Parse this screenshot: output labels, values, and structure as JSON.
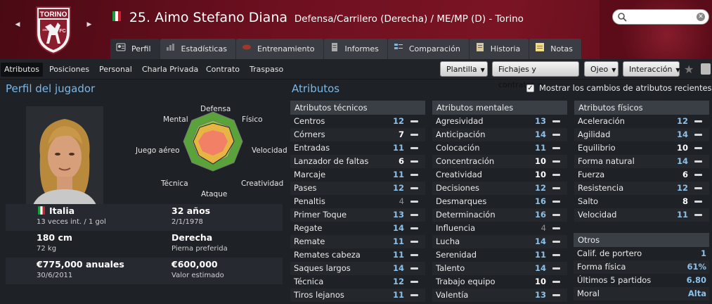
{
  "header": {
    "club_crest_text": "TORINO",
    "crest_year": "1906",
    "crest_fc": "FC",
    "player_num_name": "25. Aimo Stefano Diana",
    "player_meta": "Defensa/Carrilero (Derecha) / ME/MP (D) - Torino",
    "search_placeholder": ""
  },
  "tabs": [
    {
      "label": "Perfil",
      "icon": "profile-icon"
    },
    {
      "label": "Estadísticas",
      "icon": "stats-icon"
    },
    {
      "label": "Entrenamiento",
      "icon": "ball-icon"
    },
    {
      "label": "Informes",
      "icon": "report-icon"
    },
    {
      "label": "Comparación",
      "icon": "compare-icon"
    },
    {
      "label": "Historia",
      "icon": "history-icon"
    },
    {
      "label": "Notas",
      "icon": "notes-icon"
    }
  ],
  "subnav": {
    "items": [
      "Atributos",
      "Posiciones",
      "Personal",
      "Charla Privada",
      "Contrato",
      "Traspaso"
    ],
    "dropdowns": [
      "Plantilla",
      "Fichajes y contratos",
      "Ojeo",
      "Interacción"
    ]
  },
  "profile": {
    "heading": "Perfil del jugador",
    "radar_labels": {
      "defensa": "Defensa",
      "fisico": "Físico",
      "velocidad": "Velocidad",
      "creatividad": "Creatividad",
      "ataque": "Ataque",
      "tecnica": "Técnica",
      "juego_aereo": "Juego aéreo",
      "mental": "Mental"
    },
    "nation": "Italia",
    "caps": "13 veces int. / 1 gol",
    "age": "32 años",
    "dob": "2/1/1978",
    "height": "180 cm",
    "weight": "72 kg",
    "foot": "Derecha",
    "foot_label": "Pierna preferida",
    "wage": "€775,000 anuales",
    "contract_end": "30/6/2011",
    "value": "€600,000",
    "value_label": "Valor estimado"
  },
  "attributes": {
    "heading": "Atributos",
    "show_changes_label": "Mostrar los cambios de atributos recientes",
    "technical": {
      "title": "Atributos técnicos",
      "rows": [
        [
          "Centros",
          "12"
        ],
        [
          "Córners",
          "7"
        ],
        [
          "Entradas",
          "11"
        ],
        [
          "Lanzador de faltas",
          "6"
        ],
        [
          "Marcaje",
          "11"
        ],
        [
          "Pases",
          "12"
        ],
        [
          "Penaltis",
          "4"
        ],
        [
          "Primer Toque",
          "13"
        ],
        [
          "Regate",
          "14"
        ],
        [
          "Remate",
          "11"
        ],
        [
          "Remates cabeza",
          "11"
        ],
        [
          "Saques largos",
          "14"
        ],
        [
          "Técnica",
          "12"
        ],
        [
          "Tiros lejanos",
          "11"
        ]
      ]
    },
    "mental": {
      "title": "Atributos mentales",
      "rows": [
        [
          "Agresividad",
          "13"
        ],
        [
          "Anticipación",
          "14"
        ],
        [
          "Colocación",
          "11"
        ],
        [
          "Concentración",
          "10"
        ],
        [
          "Creatividad",
          "10"
        ],
        [
          "Decisiones",
          "12"
        ],
        [
          "Desmarques",
          "16"
        ],
        [
          "Determinación",
          "16"
        ],
        [
          "Influencia",
          "4"
        ],
        [
          "Lucha",
          "14"
        ],
        [
          "Serenidad",
          "11"
        ],
        [
          "Talento",
          "14"
        ],
        [
          "Trabajo equipo",
          "10"
        ],
        [
          "Valentía",
          "13"
        ]
      ]
    },
    "physical": {
      "title": "Atributos físicos",
      "rows": [
        [
          "Aceleración",
          "12"
        ],
        [
          "Agilidad",
          "14"
        ],
        [
          "Equilibrio",
          "10"
        ],
        [
          "Forma natural",
          "14"
        ],
        [
          "Fuerza",
          "6"
        ],
        [
          "Resistencia",
          "12"
        ],
        [
          "Salto",
          "8"
        ],
        [
          "Velocidad",
          "11"
        ]
      ]
    },
    "others": {
      "title": "Otros",
      "rows": [
        [
          "Calif. de portero",
          "1"
        ],
        [
          "Forma física",
          "61%"
        ],
        [
          "Últimos 5 partidos",
          "6.80"
        ],
        [
          "Moral",
          "Alta"
        ]
      ]
    }
  },
  "colors": {
    "accent": "#7ab8e8",
    "header": "#6e1020",
    "value_blue": "#8ec1e8"
  }
}
